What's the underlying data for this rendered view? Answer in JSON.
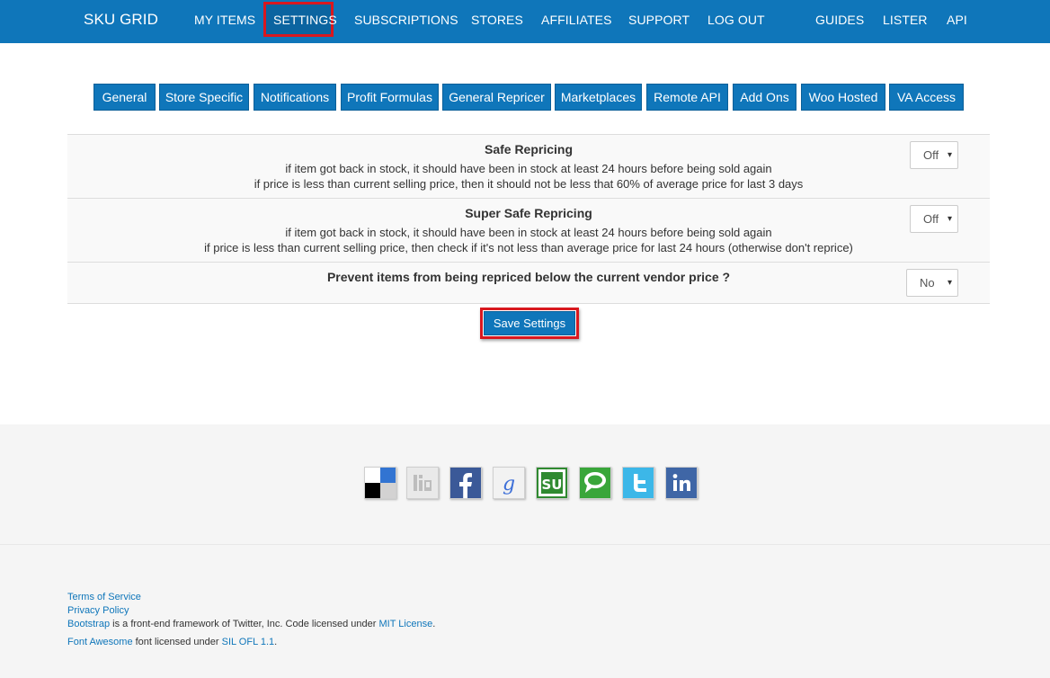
{
  "navbar": {
    "brand": "SKU GRID",
    "items": [
      {
        "label": "MY ITEMS"
      },
      {
        "label": "SETTINGS"
      },
      {
        "label": "SUBSCRIPTIONS"
      },
      {
        "label": "STORES"
      },
      {
        "label": "AFFILIATES"
      },
      {
        "label": "SUPPORT"
      },
      {
        "label": "LOG OUT"
      },
      {
        "label": "GUIDES"
      },
      {
        "label": "LISTER"
      },
      {
        "label": "API"
      }
    ]
  },
  "tabs": [
    {
      "label": "General"
    },
    {
      "label": "Store Specific"
    },
    {
      "label": "Notifications"
    },
    {
      "label": "Profit Formulas"
    },
    {
      "label": "General Repricer"
    },
    {
      "label": "Marketplaces"
    },
    {
      "label": "Remote API"
    },
    {
      "label": "Add Ons"
    },
    {
      "label": "Woo Hosted"
    },
    {
      "label": "VA Access"
    }
  ],
  "settings": {
    "safe": {
      "title": "Safe Repricing",
      "line1": "if item got back in stock, it should have been in stock at least 24 hours before being sold again",
      "line2": "if price is less than current selling price, then it should not be less that 60% of average price for last 3 days",
      "value": "Off"
    },
    "super_safe": {
      "title": "Super Safe Repricing",
      "line1": "if item got back in stock, it should have been in stock at least 24 hours before being sold again",
      "line2": "if price is less than current selling price, then check if it's not less than average price for last 24 hours (otherwise don't reprice)",
      "value": "Off"
    },
    "prevent": {
      "title": "Prevent items from being repriced below the current vendor price ?",
      "value": "No"
    },
    "caret": "▾"
  },
  "save_label": "Save Settings",
  "share_icons": [
    "delicious-icon",
    "digg-icon",
    "facebook-icon",
    "google-icon",
    "stumbleupon-icon",
    "technorati-icon",
    "twitter-icon",
    "linkedin-icon"
  ],
  "footer": {
    "terms": "Terms of Service",
    "privacy": "Privacy Policy",
    "bootstrap_link": "Bootstrap",
    "bootstrap_text": " is a front-end framework of Twitter, Inc. Code licensed under ",
    "mit_link": "MIT License",
    "period1": ".",
    "fa_link": "Font Awesome",
    "fa_text": " font licensed under ",
    "ofl_link": "SIL OFL 1.1",
    "period2": "."
  },
  "colors": {
    "primary": "#0f76ba",
    "highlight": "#d9181f",
    "footer_bg": "#f5f5f5"
  }
}
